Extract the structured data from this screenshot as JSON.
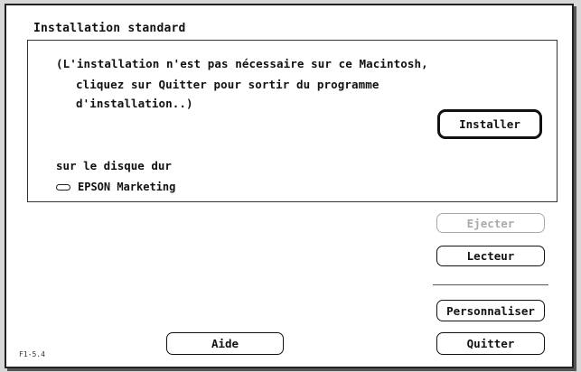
{
  "dialog": {
    "group_title": "Installation standard",
    "message_line1": "(L'installation n'est pas nécessaire sur ce Macintosh,",
    "message_line2": "cliquez sur Quitter pour sortir du programme",
    "message_line3": "d'installation..)",
    "disk_label": "sur le disque dur",
    "disk_name": "EPSON Marketing",
    "version": "F1-5.4"
  },
  "buttons": {
    "install": "Installer",
    "eject": "Ejecter",
    "drive": "Lecteur",
    "customize": "Personnaliser",
    "help": "Aide",
    "quit": "Quitter"
  },
  "state": {
    "eject_enabled": false,
    "default_button": "install"
  },
  "icons": {
    "disk": "hard-disk-icon"
  },
  "colors": {
    "background": "#ffffff",
    "text": "#111111",
    "disabled_text": "#aaaaaa"
  }
}
